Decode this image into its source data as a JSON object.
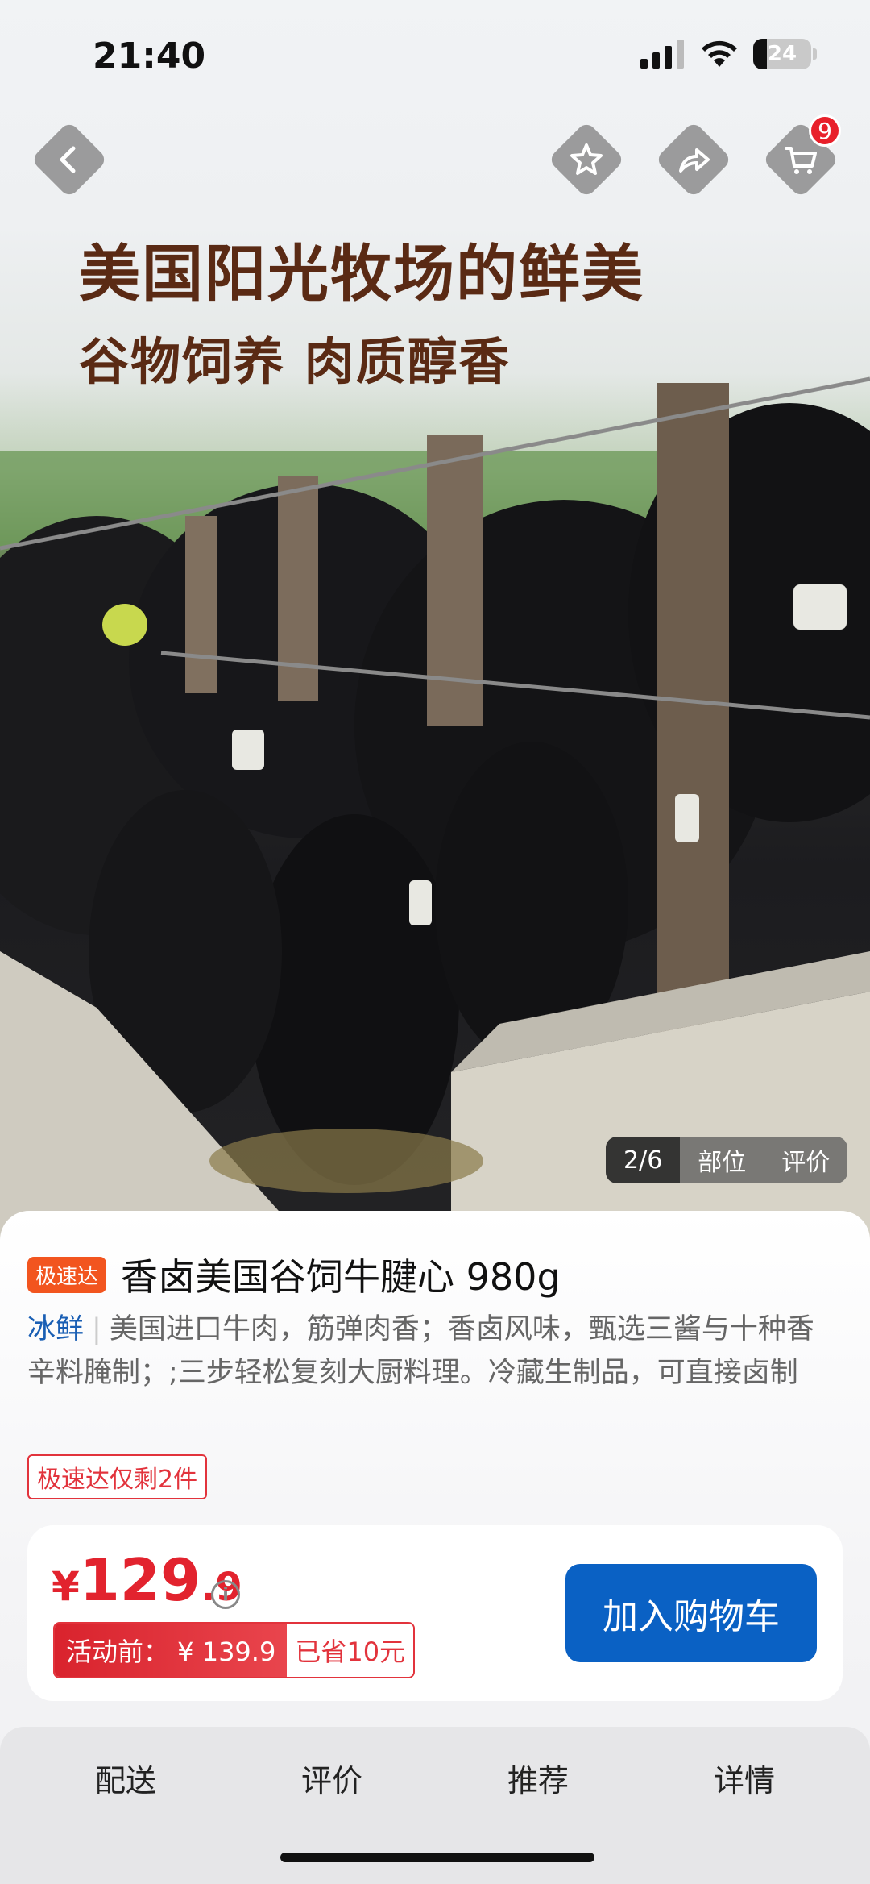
{
  "status_bar": {
    "time": "21:40",
    "battery": "24"
  },
  "hero": {
    "title": "美国阳光牧场的鲜美",
    "subtitle": "谷物饲养 肉质醇香",
    "image_tabs": {
      "index": "2/6",
      "part": "部位",
      "review": "评价"
    }
  },
  "nav": {
    "cart_badge": "9",
    "icons": [
      "back-icon",
      "star-icon",
      "share-icon",
      "cart-icon"
    ]
  },
  "product": {
    "fast_tag": "极速达",
    "title": "香卤美国谷饲牛腱心 980g",
    "fresh_label": "冰鲜",
    "separator": "|",
    "description": "美国进口牛肉，筋弹肉香；香卤风味，甄选三酱与十种香辛料腌制；;三步轻松复刻大厨料理。冷藏生制品，可直接卤制",
    "stock_tag": "极速达仅剩2件"
  },
  "price": {
    "currency": "¥",
    "integer": "129",
    "decimal": ".9",
    "info_icon": "i",
    "before_label": "活动前： ¥ 139.9",
    "saved_label": "已省10元",
    "cart_button": "加入购物车"
  },
  "bottom_tabs": [
    "配送",
    "评价",
    "推荐",
    "详情"
  ],
  "colors": {
    "accent_red": "#e2232e",
    "cart_blue": "#0a61c4",
    "fast_orange": "#f2551f",
    "fresh_blue": "#1a5fb4"
  }
}
